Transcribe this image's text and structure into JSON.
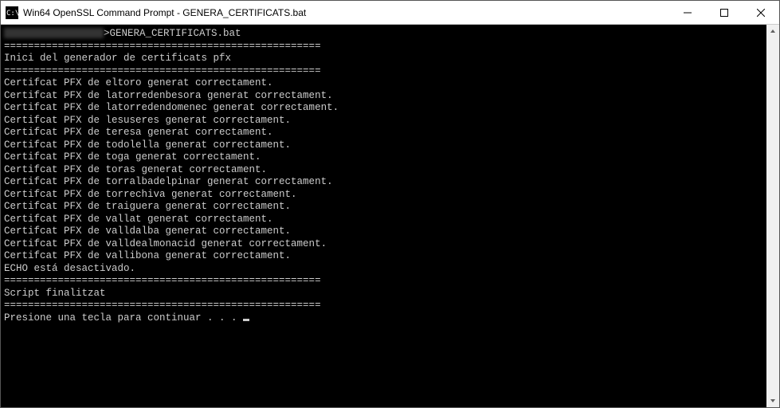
{
  "window": {
    "title": "Win64 OpenSSL Command Prompt - GENERA_CERTIFICATS.bat"
  },
  "terminal": {
    "prompt_cmd": ">GENERA_CERTIFICATS.bat",
    "sep": "=====================================================",
    "header": "Inici del generador de certificats pfx",
    "lines": [
      "Certifcat PFX de eltoro generat correctament.",
      "Certifcat PFX de latorredenbesora generat correctament.",
      "Certifcat PFX de latorredendomenec generat correctament.",
      "Certifcat PFX de lesuseres generat correctament.",
      "Certifcat PFX de teresa generat correctament.",
      "Certifcat PFX de todolella generat correctament.",
      "Certifcat PFX de toga generat correctament.",
      "Certifcat PFX de toras generat correctament.",
      "Certifcat PFX de torralbadelpinar generat correctament.",
      "Certifcat PFX de torrechiva generat correctament.",
      "Certifcat PFX de traiguera generat correctament.",
      "Certifcat PFX de vallat generat correctament.",
      "Certifcat PFX de valldalba generat correctament.",
      "Certifcat PFX de valldealmonacid generat correctament.",
      "Certifcat PFX de vallibona generat correctament."
    ],
    "echo_off": "ECHO está desactivado.",
    "finished": "Script finalitzat",
    "press_key": "Presione una tecla para continuar . . . "
  }
}
